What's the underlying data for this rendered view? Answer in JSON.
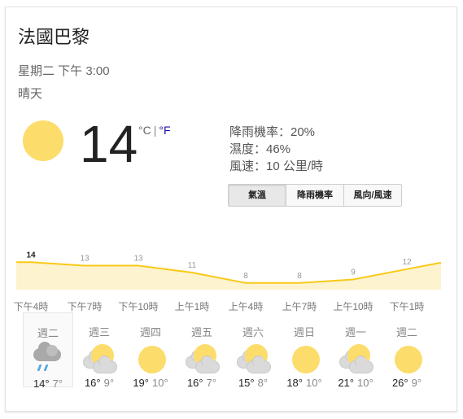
{
  "header": {
    "location": "法國巴黎",
    "datetime": "星期二 下午 3:00",
    "condition": "晴天"
  },
  "current": {
    "icon": "sunny-icon",
    "temperature": "14",
    "unit_c": "°C",
    "unit_sep": "|",
    "unit_f": "°F",
    "precipitation": "降雨機率：20%",
    "humidity": "濕度：46%",
    "wind": "風速：10 公里/時"
  },
  "tabs": [
    "氣溫",
    "降雨機率",
    "風向/風速"
  ],
  "colors": {
    "sun": "#fcdc6b",
    "chart_line": "#f9c918",
    "chart_fill": "#fdf3cf",
    "link": "#1a0dab"
  },
  "chart_data": {
    "type": "area",
    "x": [
      "下午4時",
      "下午7時",
      "下午10時",
      "上午1時",
      "上午4時",
      "上午7時",
      "上午10時",
      "下午1時"
    ],
    "values": [
      14,
      13,
      13,
      11,
      8,
      8,
      9,
      12
    ],
    "ylim": [
      7,
      15
    ]
  },
  "forecast": [
    {
      "day": "週二",
      "icon": "rain-cloud-icon",
      "high": "14°",
      "low": "7°"
    },
    {
      "day": "週三",
      "icon": "partly-cloudy-icon",
      "high": "16°",
      "low": "9°"
    },
    {
      "day": "週四",
      "icon": "sunny-icon",
      "high": "19°",
      "low": "10°"
    },
    {
      "day": "週五",
      "icon": "partly-cloudy-icon",
      "high": "16°",
      "low": "7°"
    },
    {
      "day": "週六",
      "icon": "partly-cloudy-icon",
      "high": "15°",
      "low": "8°"
    },
    {
      "day": "週日",
      "icon": "sunny-icon",
      "high": "18°",
      "low": "10°"
    },
    {
      "day": "週一",
      "icon": "partly-cloudy-icon",
      "high": "21°",
      "low": "10°"
    },
    {
      "day": "週二",
      "icon": "sunny-icon",
      "high": "26°",
      "low": "9°"
    }
  ]
}
